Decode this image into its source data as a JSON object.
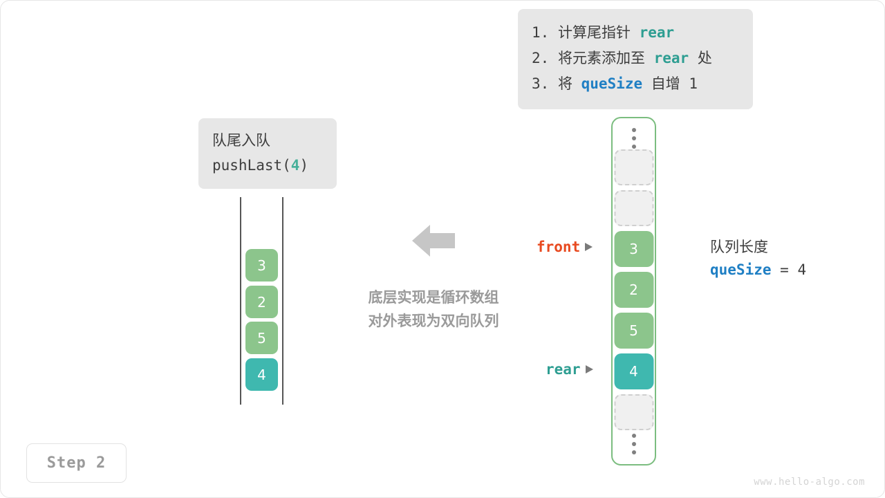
{
  "instructions": {
    "items": [
      {
        "index": "1.",
        "pre": "计算尾指针 ",
        "code": "rear",
        "code_style": "teal",
        "post": ""
      },
      {
        "index": "2.",
        "pre": "将元素添加至 ",
        "code": "rear",
        "code_style": "teal",
        "post": " 处"
      },
      {
        "index": "3.",
        "pre": "将 ",
        "code": "queSize",
        "code_style": "blue",
        "post": " 自增 1"
      }
    ]
  },
  "operation": {
    "title": "队尾入队",
    "call_prefix": "pushLast(",
    "call_value": "4",
    "call_suffix": ")"
  },
  "queue_visual": {
    "cells": [
      {
        "value": "3",
        "color": "#8cc58c"
      },
      {
        "value": "2",
        "color": "#8cc58c"
      },
      {
        "value": "5",
        "color": "#8cc58c"
      },
      {
        "value": "4",
        "color": "#3fb8af"
      }
    ]
  },
  "center_caption": {
    "line1": "底层实现是循环数组",
    "line2": "对外表现为双向队列"
  },
  "array": {
    "ellipsis_top": "⋮",
    "ellipsis_bottom": "⋮",
    "slots": [
      {
        "value": "",
        "state": "empty"
      },
      {
        "value": "",
        "state": "empty"
      },
      {
        "value": "3",
        "state": "filled",
        "color": "#8cc58c"
      },
      {
        "value": "2",
        "state": "filled",
        "color": "#8cc58c"
      },
      {
        "value": "5",
        "state": "filled",
        "color": "#8cc58c"
      },
      {
        "value": "4",
        "state": "filled",
        "color": "#3fb8af"
      },
      {
        "value": "",
        "state": "empty"
      }
    ],
    "border_color": "#7bbd7f"
  },
  "pointers": {
    "front_label": "front",
    "front_color": "#e8491f",
    "rear_label": "rear",
    "rear_color": "#2e9e92"
  },
  "size_note": {
    "title": "队列长度",
    "var_name": "queSize",
    "equals": " = ",
    "value": "4"
  },
  "step_badge": {
    "label": "Step 2"
  },
  "watermark": {
    "text": "www.hello-algo.com"
  },
  "colors": {
    "green": "#8cc58c",
    "teal": "#3fb8af",
    "blue": "#1f7fc4",
    "orange": "#e8491f",
    "gray_text": "#9a9a9a",
    "card_bg": "#e7e7e7"
  }
}
